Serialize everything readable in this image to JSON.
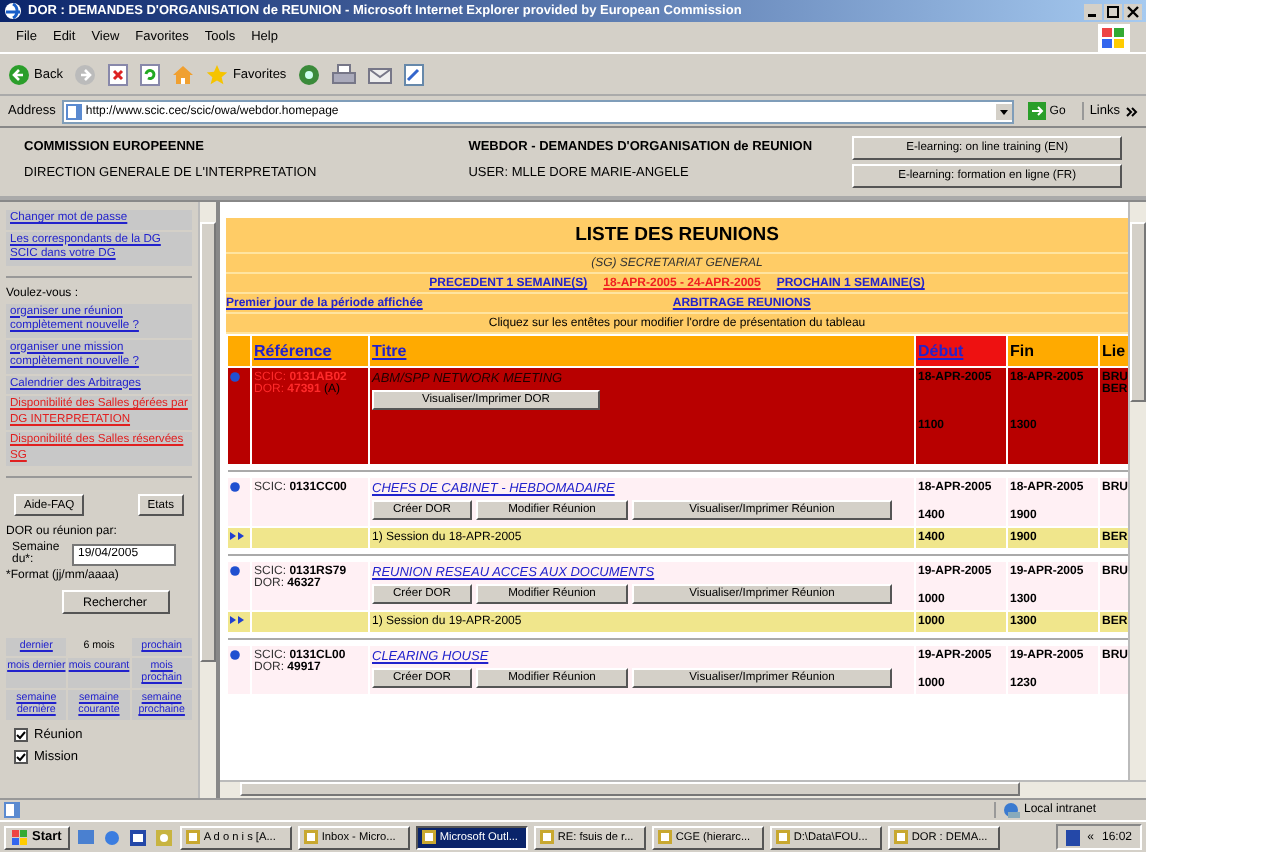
{
  "window": {
    "title": "DOR : DEMANDES D'ORGANISATION de REUNION - Microsoft Internet Explorer provided by European Commission"
  },
  "menu": [
    "File",
    "Edit",
    "View",
    "Favorites",
    "Tools",
    "Help"
  ],
  "toolbar": {
    "back": "Back",
    "favorites": "Favorites"
  },
  "address": {
    "label": "Address",
    "url": "http://www.scic.cec/scic/owa/webdor.homepage",
    "go": "Go",
    "links": "Links"
  },
  "header": {
    "org": "COMMISSION EUROPEENNE",
    "dept": "DIRECTION GENERALE DE L'INTERPRETATION",
    "app": "WEBDOR - DEMANDES D'ORGANISATION de REUNION",
    "user": "USER: MLLE DORE MARIE-ANGELE",
    "buttons": [
      "E-learning: on line training (EN)",
      "E-learning: formation en ligne (FR)"
    ]
  },
  "sidebar": {
    "top_links": [
      "Changer mot de passe",
      "Les correspondants de la DG SCIC dans votre DG"
    ],
    "prompt": "Voulez-vous :",
    "links": [
      {
        "text": "organiser une réunion complètement nouvelle ?",
        "kind": "normal"
      },
      {
        "text": "organiser une mission complètement nouvelle ?",
        "kind": "normal"
      },
      {
        "text": "Calendrier des Arbitrages",
        "kind": "normal"
      },
      {
        "text": "Disponibilité des Salles gérées par DG INTERPRETATION",
        "kind": "alert"
      },
      {
        "text": "Disponibilité des Salles réservées SG",
        "kind": "alert"
      }
    ],
    "buttons": [
      "Aide-FAQ",
      "Etats"
    ],
    "search_label": "DOR ou réunion par:",
    "week_label": "Semaine du*:",
    "week_value": "19/04/2005",
    "format": "*Format (jj/mm/aaaa)",
    "search_button": "Rechercher",
    "periods": [
      {
        "text": "dernier",
        "kind": "link"
      },
      {
        "text": "6 mois",
        "kind": "plain"
      },
      {
        "text": "prochain",
        "kind": "link"
      },
      {
        "text": "mois dernier",
        "kind": "link"
      },
      {
        "text": "mois courant",
        "kind": "link"
      },
      {
        "text": "mois prochain",
        "kind": "link"
      },
      {
        "text": "semaine dernière",
        "kind": "link"
      },
      {
        "text": "semaine courante",
        "kind": "link"
      },
      {
        "text": "semaine prochaine",
        "kind": "link"
      }
    ],
    "filters": [
      {
        "label": "Réunion",
        "checked": true
      },
      {
        "label": "Mission",
        "checked": true
      }
    ]
  },
  "main": {
    "title": "LISTE DES REUNIONS",
    "subtitle": "(SG) SECRETARIAT GENERAL",
    "prev": "PRECEDENT 1 SEMAINE(S)",
    "period": "18-APR-2005 - 24-APR-2005",
    "next": "PROCHAIN 1 SEMAINE(S)",
    "first_day": "Premier jour de la période affichée",
    "arbitrage": "ARBITRAGE REUNIONS",
    "hint": "Cliquez sur les entêtes pour modifier l'ordre de présentation du tableau",
    "columns": [
      {
        "label": "Référence",
        "sorted": false,
        "link": true
      },
      {
        "label": "Titre",
        "sorted": false,
        "link": true
      },
      {
        "label": "Début",
        "sorted": true,
        "link": true
      },
      {
        "label": "Fin",
        "sorted": false,
        "link": false
      },
      {
        "label": "Lie",
        "sorted": false,
        "link": false
      }
    ],
    "meetings": [
      {
        "selected": true,
        "scic_label": "SCIC:",
        "scic": "0131AB02",
        "dor_label": "DOR:",
        "dor": "47391",
        "flag": "(A)",
        "title": "ABM/SPP NETWORK MEETING",
        "buttons": [
          "Visualiser/Imprimer DOR"
        ],
        "start_date": "18-APR-2005",
        "end_date": "18-APR-2005",
        "start_time": "1100",
        "end_time": "1300",
        "locations": [
          "BRU",
          "BER"
        ]
      },
      {
        "selected": false,
        "scic_label": "SCIC:",
        "scic": "0131CC00",
        "title": "CHEFS DE CABINET - HEBDOMADAIRE",
        "buttons": [
          "Créer DOR",
          "Modifier Réunion",
          "Visualiser/Imprimer Réunion"
        ],
        "start_date": "18-APR-2005",
        "end_date": "18-APR-2005",
        "start_time": "1400",
        "end_time": "1900",
        "locations": [
          "BRU"
        ],
        "sessions": [
          {
            "label": "1) Session du 18-APR-2005",
            "start": "1400",
            "end": "1900",
            "location": "BER"
          }
        ]
      },
      {
        "selected": false,
        "scic_label": "SCIC:",
        "scic": "0131RS79",
        "dor_label": "DOR:",
        "dor": "46327",
        "title": "REUNION RESEAU ACCES AUX DOCUMENTS",
        "buttons": [
          "Créer DOR",
          "Modifier Réunion",
          "Visualiser/Imprimer Réunion"
        ],
        "start_date": "19-APR-2005",
        "end_date": "19-APR-2005",
        "start_time": "1000",
        "end_time": "1300",
        "locations": [
          "BRU"
        ],
        "sessions": [
          {
            "label": "1) Session du 19-APR-2005",
            "start": "1000",
            "end": "1300",
            "location": "BER"
          }
        ]
      },
      {
        "selected": false,
        "scic_label": "SCIC:",
        "scic": "0131CL00",
        "dor_label": "DOR:",
        "dor": "49917",
        "title": "CLEARING HOUSE",
        "buttons": [
          "Créer DOR",
          "Modifier Réunion",
          "Visualiser/Imprimer Réunion"
        ],
        "start_date": "19-APR-2005",
        "end_date": "19-APR-2005",
        "start_time": "1000",
        "end_time": "1230",
        "locations": [
          "BRU"
        ]
      }
    ]
  },
  "status": {
    "zone": "Local intranet"
  },
  "taskbar": {
    "start": "Start",
    "tasks": [
      {
        "label": "A d o n i s  [A...",
        "selected": false
      },
      {
        "label": "Inbox - Micro...",
        "selected": false
      },
      {
        "label": "Microsoft Outl...",
        "selected": true
      },
      {
        "label": "RE: fsuis de r...",
        "selected": false
      },
      {
        "label": "CGE (hierarc...",
        "selected": false
      },
      {
        "label": "D:\\Data\\FOU...",
        "selected": false
      },
      {
        "label": "DOR : DEMA...",
        "selected": false
      }
    ],
    "chevron": "«",
    "clock": "16:02"
  }
}
